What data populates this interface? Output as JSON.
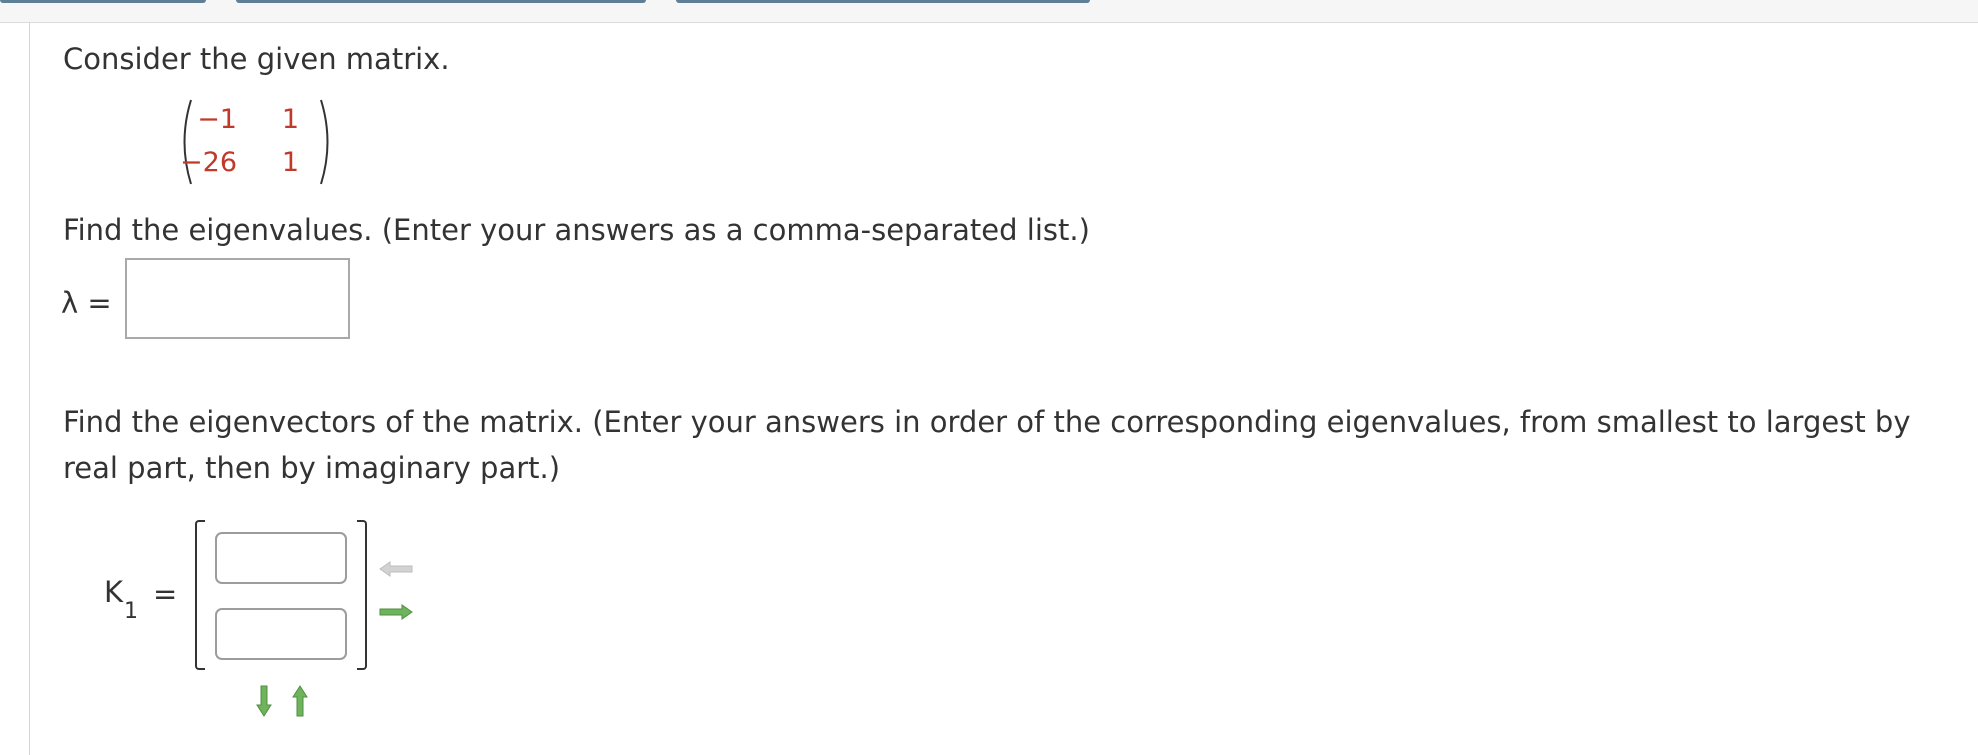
{
  "intro": {
    "text": "Consider the given matrix."
  },
  "matrix": {
    "rows": [
      [
        "−1",
        "1"
      ],
      [
        "−26",
        "1"
      ]
    ],
    "entry_color": "#c0392b"
  },
  "eigenvalues": {
    "prompt": "Find the eigenvalues. (Enter your answers as a comma-separated list.)",
    "label": "λ =",
    "value": ""
  },
  "eigenvectors": {
    "prompt_line1": "Find the eigenvectors of the matrix. (Enter your answers in order of the corresponding eigenvalues, from smallest to largest by",
    "prompt_line2": "real part, then by imaginary part.)",
    "vector_label_main": "K",
    "vector_label_sub": "1",
    "vector_label_eq": "=",
    "components": [
      "",
      ""
    ],
    "icons": {
      "remove_column": "left-arrow-icon",
      "add_column": "right-arrow-icon",
      "add_row": "down-arrow-icon",
      "remove_row": "up-arrow-icon"
    },
    "active_icon_color": "#5a9e4b",
    "inactive_icon_color": "#c8c8c8"
  }
}
